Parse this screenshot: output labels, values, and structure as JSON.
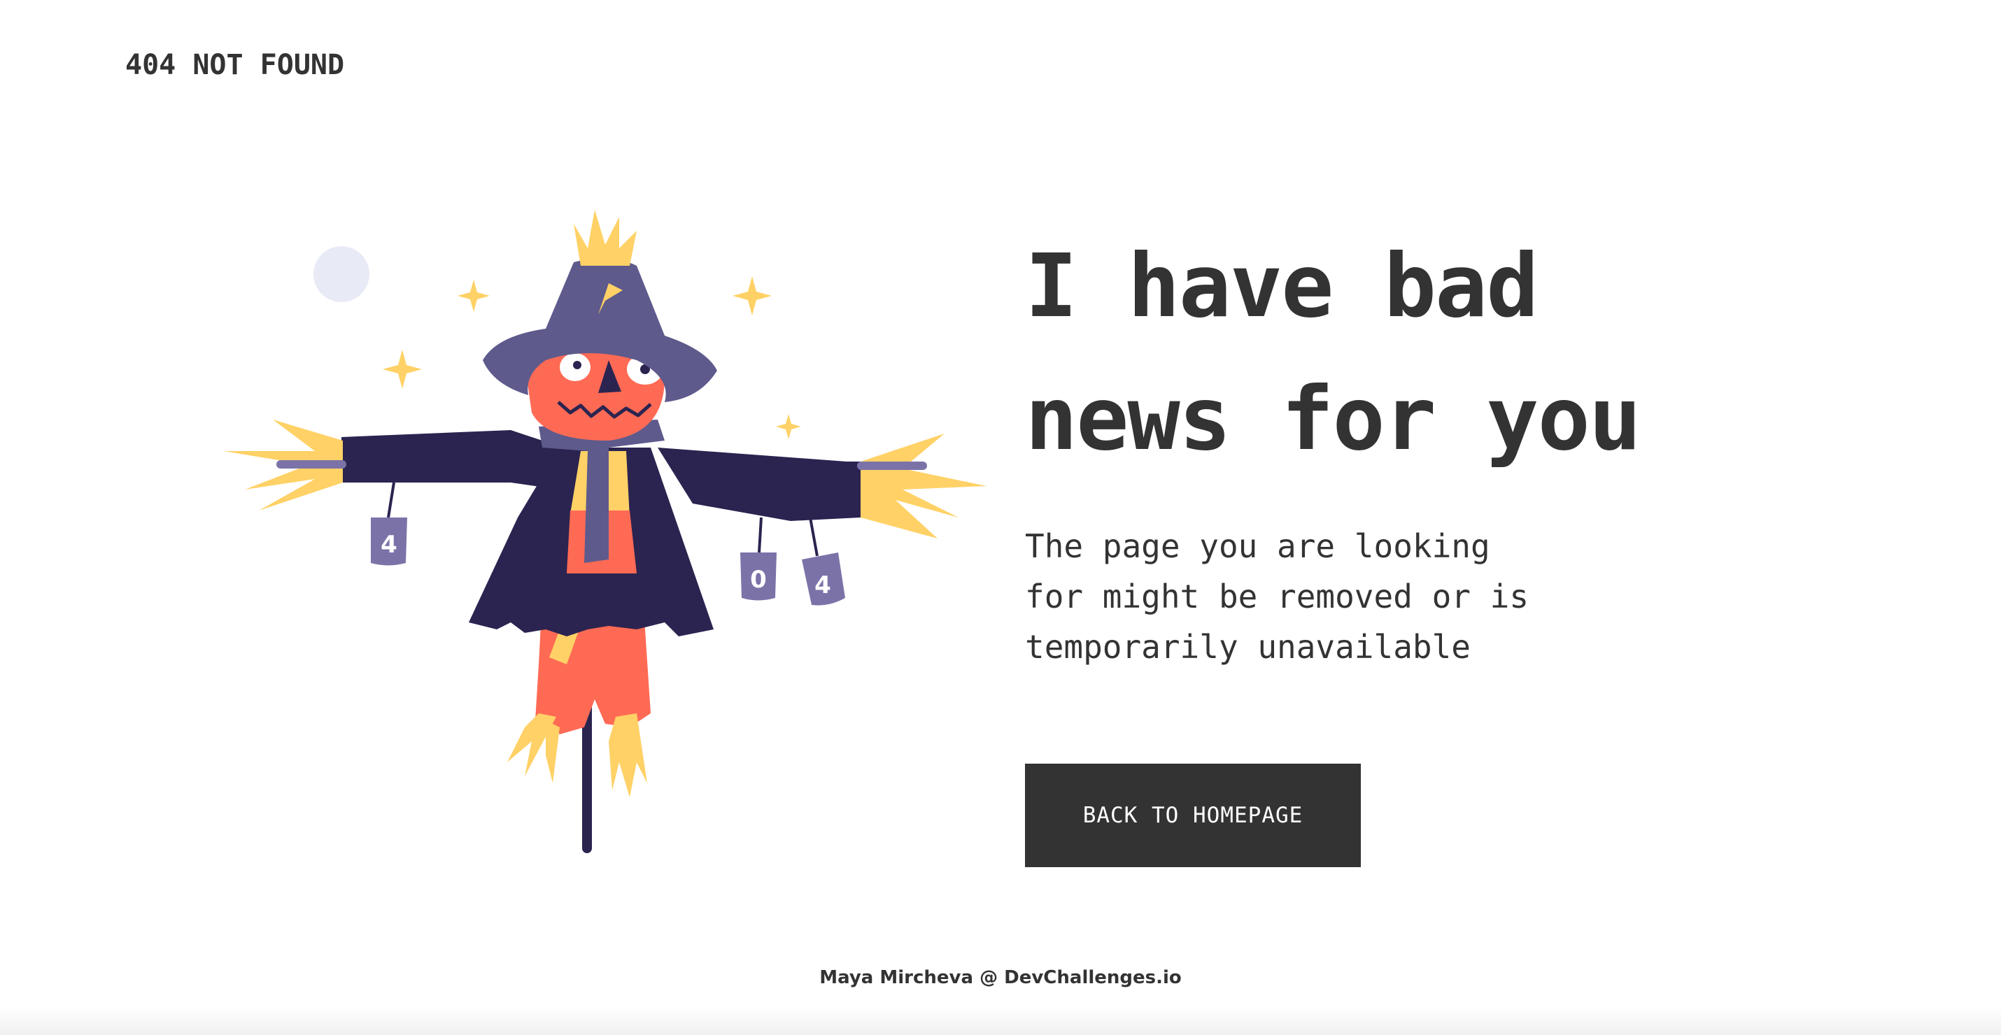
{
  "header": {
    "logo": "404 NOT FOUND"
  },
  "main": {
    "headline_line1": "I have bad",
    "headline_line2": "news for you",
    "message_line1": "The page you are looking",
    "message_line2": "for might be removed or is",
    "message_line3": "temporarily unavailable",
    "button_label": "BACK TO HOMEPAGE"
  },
  "illustration": {
    "can_labels": [
      "4",
      "0",
      "4"
    ]
  },
  "footer": {
    "credit": "Maya Mircheva @ DevChallenges.io"
  },
  "colors": {
    "text": "#333333",
    "button_bg": "#333333",
    "button_text": "#ffffff",
    "coat": "#2B2450",
    "hat": "#5E5A8C",
    "head": "#FF6A55",
    "straw": "#FFD166",
    "can": "#7B73A8"
  }
}
